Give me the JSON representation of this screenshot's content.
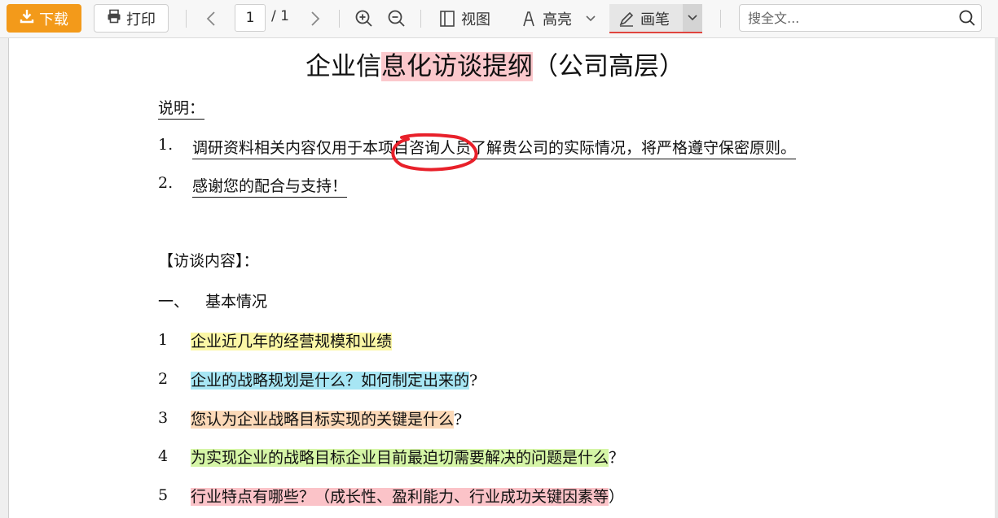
{
  "toolbar": {
    "download_label": "下载",
    "print_label": "打印",
    "page_current": "1",
    "page_total": "/ 1",
    "view_label": "视图",
    "highlight_label": "高亮",
    "pen_label": "画笔",
    "search_placeholder": "搜全文...",
    "accent_color": "#f39a1a",
    "pen_underline_color": "#e0443e"
  },
  "document": {
    "title_pre": "企业信",
    "title_highlight": "息化访谈提纲",
    "title_post": "（公司高层）",
    "notes_label": "说明：",
    "notes": [
      {
        "num": "1.",
        "text": "调研资料相关内容仅用于本项目咨询人员了解贵公司的实际情况，将严格遵守保密原则。"
      },
      {
        "num": "2.",
        "text": "感谢您的配合与支持！"
      }
    ],
    "section_heading": "【访谈内容】：",
    "subsection_num": "一、",
    "subsection_title": "基本情况",
    "questions": [
      {
        "num": "1",
        "text": "企业近几年的经营规模和业绩",
        "tail": "",
        "highlight": "yellow"
      },
      {
        "num": "2",
        "text": "企业的战略规划是什么？如何制定出来的",
        "tail": "?",
        "highlight": "blue"
      },
      {
        "num": "3",
        "text": "您认为企业战略目标实现的关键是什么",
        "tail": "?",
        "highlight": "orange"
      },
      {
        "num": "4",
        "text": "为实现企业的战略目标企业目前最迫切需要解决的问题是什么",
        "tail": "？",
        "highlight": "green"
      },
      {
        "num": "5",
        "text": "行业特点有哪些？（成长性、盈利能力、行业成功关键因素等",
        "tail": "）",
        "highlight": "pink"
      }
    ],
    "ink_circle_color": "#e8202a"
  }
}
